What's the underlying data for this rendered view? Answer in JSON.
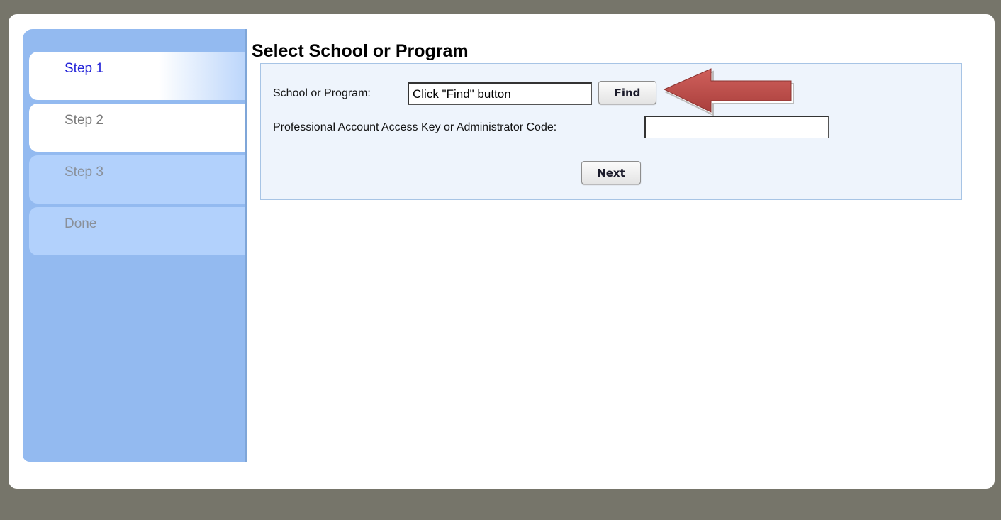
{
  "sidebar": {
    "steps": [
      {
        "label": "Step 1",
        "state": "active"
      },
      {
        "label": "Step 2",
        "state": "next"
      },
      {
        "label": "Step 3",
        "state": "disabled"
      },
      {
        "label": "Done",
        "state": "disabled"
      }
    ]
  },
  "main": {
    "title": "Select School or Program",
    "form": {
      "school_label": "School or Program:",
      "school_value": "Click \"Find\" button",
      "find_label": "Find",
      "key_label": "Professional Account Access Key or Administrator Code:",
      "key_value": "",
      "next_label": "Next"
    },
    "annotation": {
      "icon": "arrow-left-icon",
      "color": "#c0504d"
    }
  },
  "colors": {
    "page_background": "#76756a",
    "sidebar_background": "#93baf0",
    "step_active_text": "#2323d8",
    "panel_background": "#eef4fc",
    "panel_border": "#a7c4e5"
  }
}
